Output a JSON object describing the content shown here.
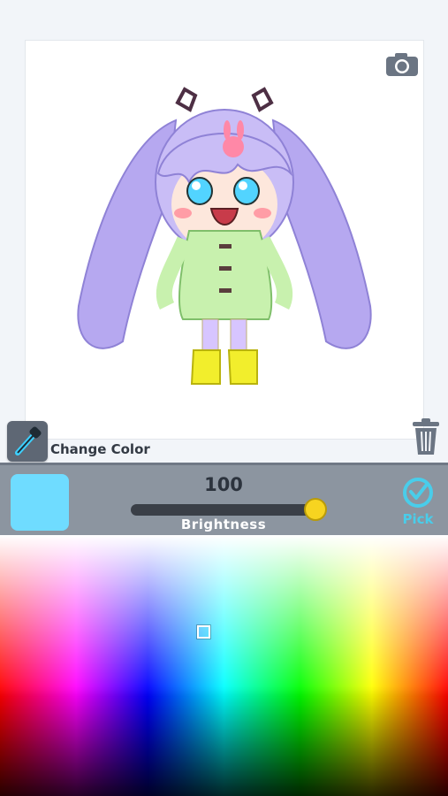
{
  "toolbar": {
    "change_color_label": "Change Color",
    "camera_icon": "camera-icon",
    "eyedropper_icon": "eyedropper-icon",
    "trash_icon": "trash-icon"
  },
  "color_panel": {
    "brightness_value": "100",
    "brightness_label": "Brightness",
    "brightness_level": 1.0,
    "selected_color": "#6fdcff",
    "pick_label": "Pick",
    "pick_color": "#49cdea"
  }
}
